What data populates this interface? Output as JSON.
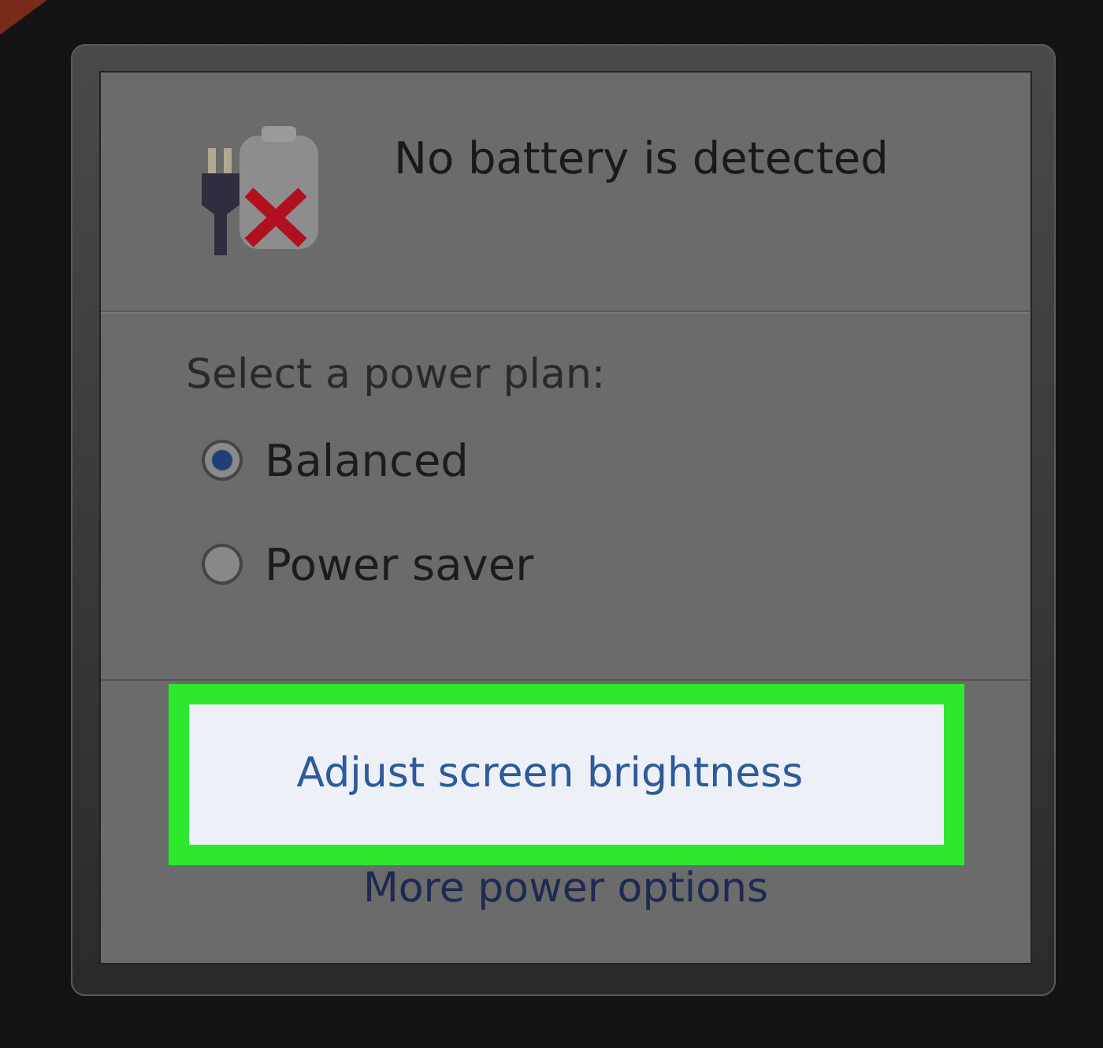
{
  "status": {
    "message": "No battery is detected"
  },
  "power_plans": {
    "label": "Select a power plan:",
    "options": [
      {
        "label": "Balanced",
        "selected": true
      },
      {
        "label": "Power saver",
        "selected": false
      }
    ]
  },
  "links": [
    {
      "label": "Adjust screen brightness",
      "highlighted": true
    },
    {
      "label": "More power options",
      "highlighted": false
    }
  ]
}
